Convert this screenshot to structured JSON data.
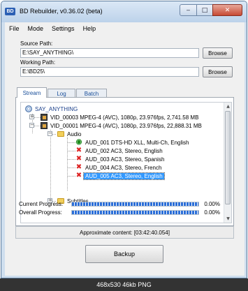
{
  "window": {
    "title": "BD Rebuilder, v0.36.02 (beta)",
    "icon_text": "BD"
  },
  "menu": [
    "File",
    "Mode",
    "Settings",
    "Help"
  ],
  "source": {
    "label": "Source Path:",
    "value": "E:\\SAY_ANYTHING\\",
    "browse_label": "Browse"
  },
  "working": {
    "label": "Working Path:",
    "value": "E:\\BD25\\",
    "browse_label": "Browse"
  },
  "tabs": [
    "Stream",
    "Log",
    "Batch"
  ],
  "tree": {
    "root": "SAY_ANYTHING",
    "vid1": "VID_00003 MPEG-4 (AVC), 1080p, 23.976fps, 2,741.58 MB",
    "vid2": "VID_00001 MPEG-4 (AVC), 1080p, 23.976fps, 22,888.31 MB",
    "audio_folder": "Audio",
    "audio_items": [
      "AUD_001 DTS-HD XLL, Multi-Ch, English",
      "AUD_002 AC3, Stereo, English",
      "AUD_003 AC3, Stereo, Spanish",
      "AUD_004 AC3, Stereo, French",
      "AUD_005 AC3, Stereo, English"
    ],
    "subtitles_folder": "Subtitles"
  },
  "progress": {
    "current_label": "Current Progress:",
    "current_pct": "0.00%",
    "overall_label": "Overall Progress:",
    "overall_pct": "0.00%"
  },
  "approx": "Approximate content: [03:42:40.054]",
  "backup_label": "Backup",
  "footer": "468x530  46kb  PNG",
  "colors": {
    "accent": "#2a6ed8",
    "selection": "#3399ff",
    "remove_mark": "#dd2222"
  }
}
